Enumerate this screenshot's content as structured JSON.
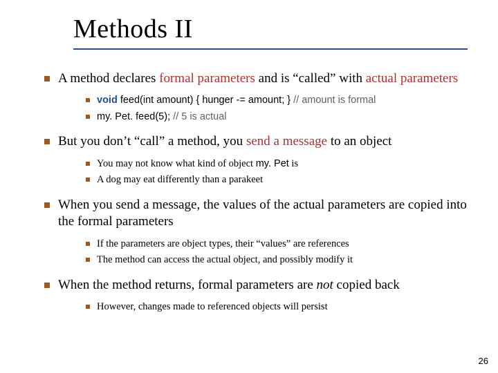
{
  "title": "Methods II",
  "p1_a": "A method declares ",
  "p1_b": "formal parameters",
  "p1_c": " and is “called” with ",
  "p1_d": "actual parameters",
  "c1_kw": "void",
  "c1_code": " feed(int amount) { hunger -= amount; } ",
  "c1_comment": "// amount is formal",
  "c2_code": "my. Pet. feed(5); ",
  "c2_comment": "// 5 is actual",
  "p2_a": "But you don’t “call” a method, you ",
  "p2_b": "send a message",
  "p2_c": " to an object",
  "s2a_a": "You may not know what kind of object ",
  "s2a_b": "my. Pet",
  "s2a_c": " is",
  "s2b": "A dog may eat differently than a parakeet",
  "p3": "When you send a message, the values of the actual parameters are copied into the formal parameters",
  "s3a": "If the parameters are object types, their “values” are references",
  "s3b": "The method can access the actual object, and possibly modify it",
  "p4_a": "When the method returns, formal parameters are ",
  "p4_b": "not",
  "p4_c": " copied back",
  "s4a": "However, changes made to referenced objects will persist",
  "page": "26"
}
